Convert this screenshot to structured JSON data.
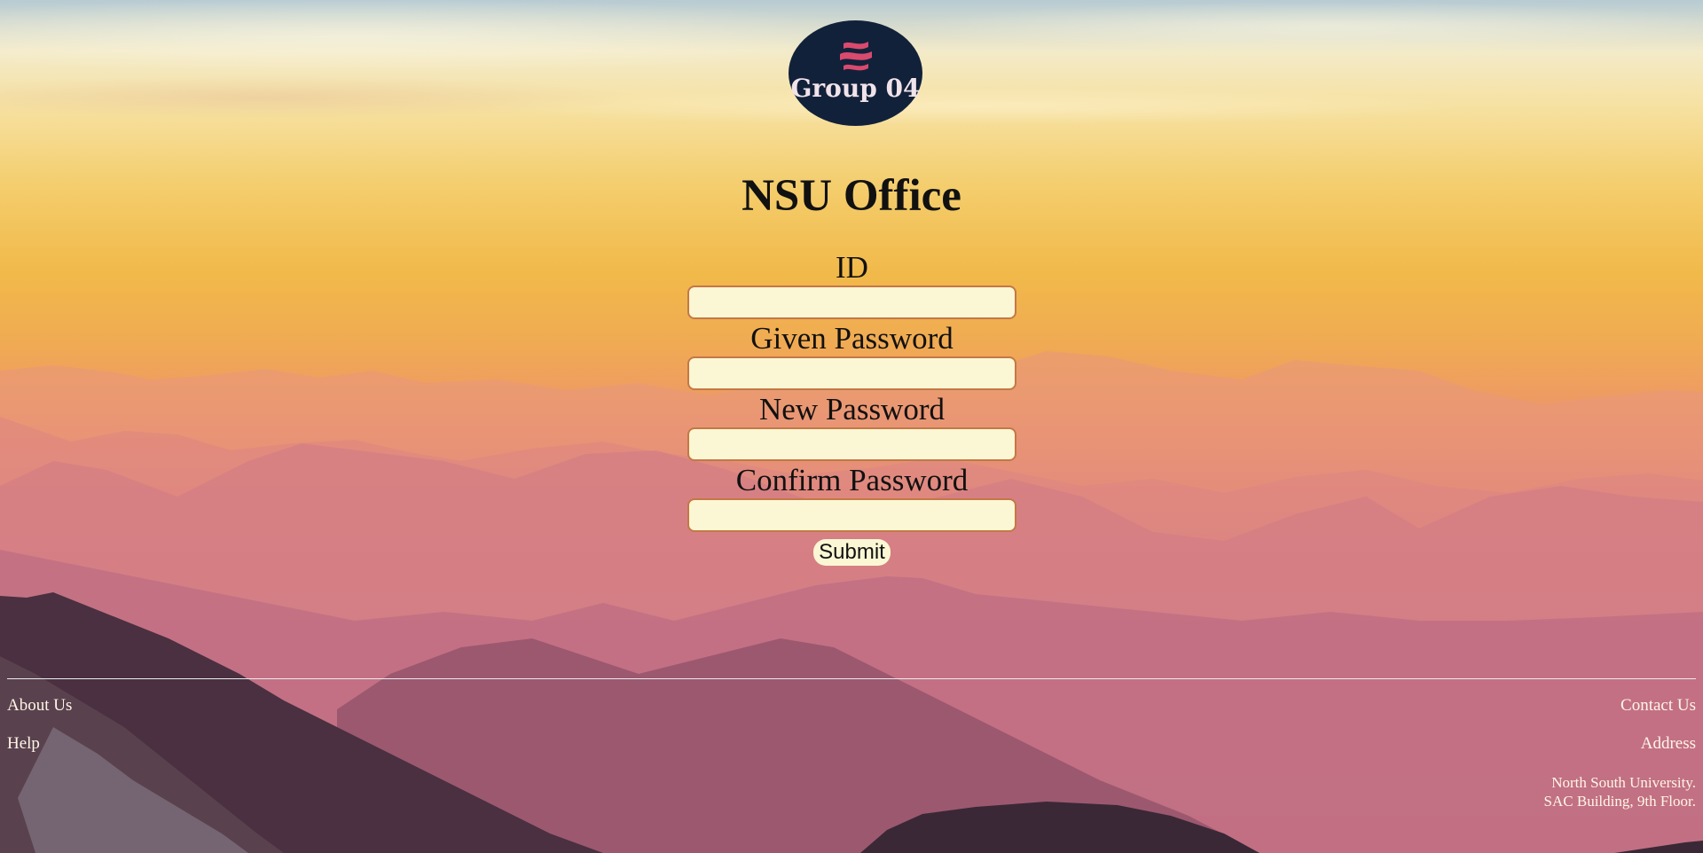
{
  "logo": {
    "text": "Group 04",
    "icon": "wave-emblem-icon",
    "background_color": "#12213a",
    "emblem_color": "#d94a6e"
  },
  "page": {
    "title": "NSU Office"
  },
  "form": {
    "id_label": "ID",
    "id_value": "",
    "given_password_label": "Given Password",
    "given_password_value": "",
    "new_password_label": "New Password",
    "new_password_value": "",
    "confirm_password_label": "Confirm Password",
    "confirm_password_value": "",
    "submit_label": "Submit",
    "input_background_color": "#fbf7d4",
    "input_border_color": "#c47845"
  },
  "footer": {
    "about_us": "About Us",
    "help": "Help",
    "contact_us": "Contact Us",
    "address": "Address",
    "address_line1": "North South University.",
    "address_line2": "SAC Building, 9th Floor.",
    "text_color": "#fff6e8"
  }
}
